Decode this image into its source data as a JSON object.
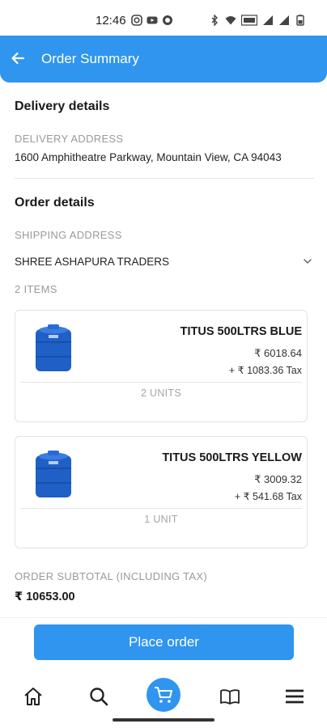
{
  "status_bar": {
    "time": "12:46"
  },
  "app_bar": {
    "title": "Order Summary",
    "back_icon": "arrow-left-icon"
  },
  "delivery": {
    "heading": "Delivery details",
    "address_label": "DELIVERY ADDRESS",
    "address": "1600 Amphitheatre Parkway, Mountain View, CA 94043"
  },
  "order": {
    "heading": "Order details",
    "shipping_label": "SHIPPING ADDRESS",
    "shipping_value": "SHREE ASHAPURA TRADERS",
    "items_count_label": "2 ITEMS",
    "items": [
      {
        "name": "TITUS 500LTRS BLUE",
        "price": "₹ 6018.64",
        "tax": "+ ₹ 1083.36 Tax",
        "units": "2 UNITS"
      },
      {
        "name": "TITUS 500LTRS YELLOW",
        "price": "₹ 3009.32",
        "tax": "+ ₹ 541.68 Tax",
        "units": "1 UNIT"
      }
    ],
    "subtotal_label": "ORDER SUBTOTAL (INCLUDING TAX)",
    "subtotal_value": "₹ 10653.00"
  },
  "actions": {
    "place_order": "Place order"
  },
  "nav": {
    "items": [
      "home-icon",
      "search-icon",
      "cart-icon",
      "book-icon",
      "menu-icon"
    ]
  },
  "colors": {
    "accent": "#2f95ef",
    "tank": "#1f5fc6"
  }
}
